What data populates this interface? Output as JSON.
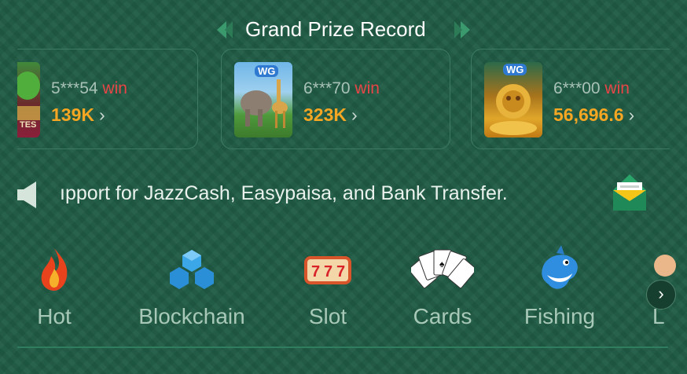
{
  "header": {
    "title": "Grand Prize Record"
  },
  "records": [
    {
      "user": "5***54",
      "win_label": "win",
      "amount": "139K"
    },
    {
      "user": "6***70",
      "win_label": "win",
      "amount": "323K"
    },
    {
      "user": "6***00",
      "win_label": "win",
      "amount": "56,696.6"
    }
  ],
  "thumb_badge": "WG",
  "partial_thumb_text": "TES",
  "notice": {
    "text": "ıpport for JazzCash, Easypaisa, and Bank Transfer."
  },
  "categories": [
    {
      "label": "Hot",
      "icon": "flame-icon"
    },
    {
      "label": "Blockchain",
      "icon": "blockchain-icon"
    },
    {
      "label": "Slot",
      "icon": "slot-machine-icon"
    },
    {
      "label": "Cards",
      "icon": "playing-cards-icon"
    },
    {
      "label": "Fishing",
      "icon": "shark-icon"
    },
    {
      "label": "L",
      "icon": "game-icon"
    }
  ],
  "colors": {
    "background": "#1f5a44",
    "accent_amount": "#f5a623",
    "win": "#e84646",
    "muted": "#a9c9b8"
  }
}
